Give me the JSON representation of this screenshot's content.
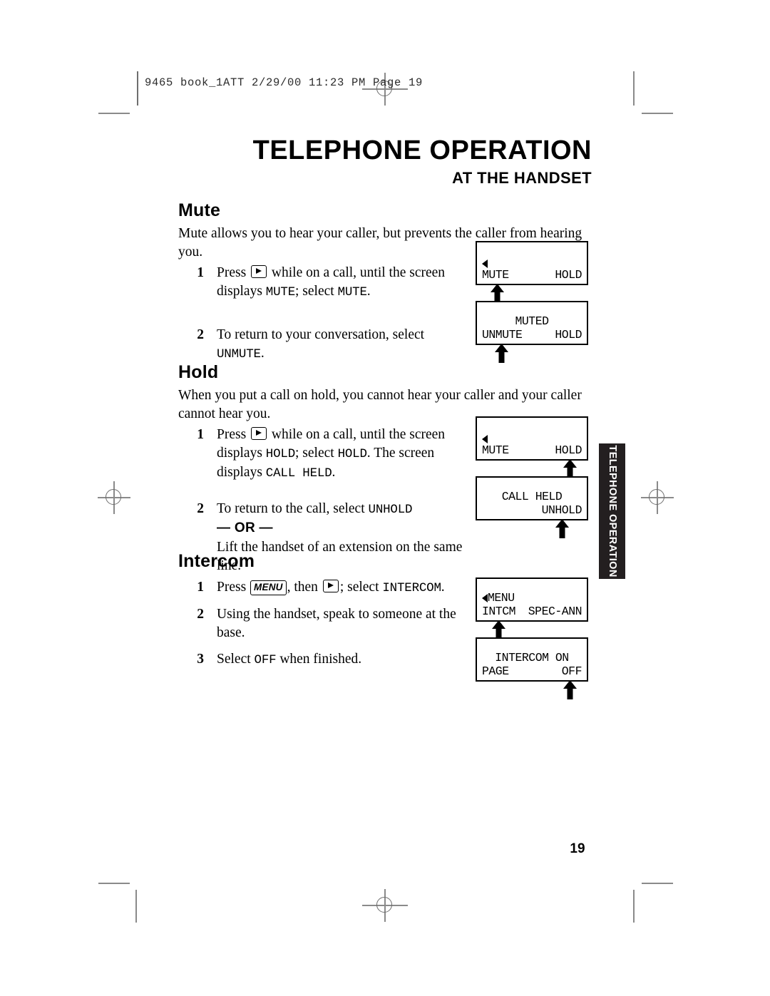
{
  "printer_slug": {
    "text": "9465 book_1ATT  2/29/00  11:23 PM  Page 19"
  },
  "header": {
    "title": "TELEPHONE OPERATION",
    "subtitle": "AT THE HANDSET"
  },
  "side_tab": {
    "label": "TELEPHONE OPERATION"
  },
  "folio": {
    "page_number": "19"
  },
  "sections": {
    "mute": {
      "heading": "Mute",
      "intro": "Mute allows you to hear your caller, but prevents the caller from hearing you.",
      "steps": [
        {
          "num": "1",
          "text_a": "Press",
          "key": "right-arrow",
          "text_b": "while on a call, until the screen displays",
          "code_a": "MUTE",
          "text_c": "; select",
          "code_b": "MUTE",
          "text_d": "."
        },
        {
          "num": "2",
          "text_a": "To return to your conversation, select",
          "code_a": "UNMUTE",
          "text_b": "."
        }
      ],
      "screens": [
        {
          "caret": true,
          "line1": "",
          "left": "MUTE",
          "right": "HOLD",
          "pointer": "left"
        },
        {
          "caret": false,
          "line1": "MUTED",
          "left": "UNMUTE",
          "right": "HOLD",
          "pointer": "left"
        }
      ]
    },
    "hold": {
      "heading": "Hold",
      "intro": "When you put a call on hold, you cannot hear your caller and your caller cannot hear you.",
      "steps": [
        {
          "num": "1",
          "text_a": "Press",
          "key": "right-arrow",
          "text_b": "while on a call, until the screen displays",
          "code_a": "HOLD",
          "text_c": "; select",
          "code_b": "HOLD",
          "text_d": ". The screen displays",
          "code_c": "CALL HELD",
          "text_e": "."
        },
        {
          "num": "2",
          "text_a": "To return to the call, select",
          "code_a": "UNHOLD",
          "or_label": "— OR —",
          "text_b": "Lift the handset of an extension on the same line."
        }
      ],
      "screens": [
        {
          "caret": true,
          "line1": "",
          "left": "MUTE",
          "right": "HOLD",
          "pointer": "right"
        },
        {
          "caret": false,
          "line1": "CALL HELD",
          "left": "",
          "right": "UNHOLD",
          "pointer": "right"
        }
      ]
    },
    "intercom": {
      "heading": "Intercom",
      "steps": [
        {
          "num": "1",
          "text_a": "Press",
          "key_menu": "MENU",
          "text_b": ", then",
          "key": "right-arrow",
          "text_c": "; select",
          "code_a": "INTERCOM",
          "text_d": "."
        },
        {
          "num": "2",
          "text_a": "Using the handset, speak to someone at the base."
        },
        {
          "num": "3",
          "text_a": "Select",
          "code_a": "OFF",
          "text_b": "when finished."
        }
      ],
      "screens": [
        {
          "caret": true,
          "line1": "MENU",
          "left": "INTCM",
          "right": "SPEC-ANN",
          "pointer": "left"
        },
        {
          "caret": false,
          "line1": "INTERCOM ON",
          "left": "PAGE",
          "right": "OFF",
          "pointer": "right"
        }
      ]
    }
  },
  "colors": {
    "ink": "#000000",
    "tab_background": "#231f20",
    "tab_text": "#ffffff",
    "mark_gray": "#8a8a8a"
  }
}
